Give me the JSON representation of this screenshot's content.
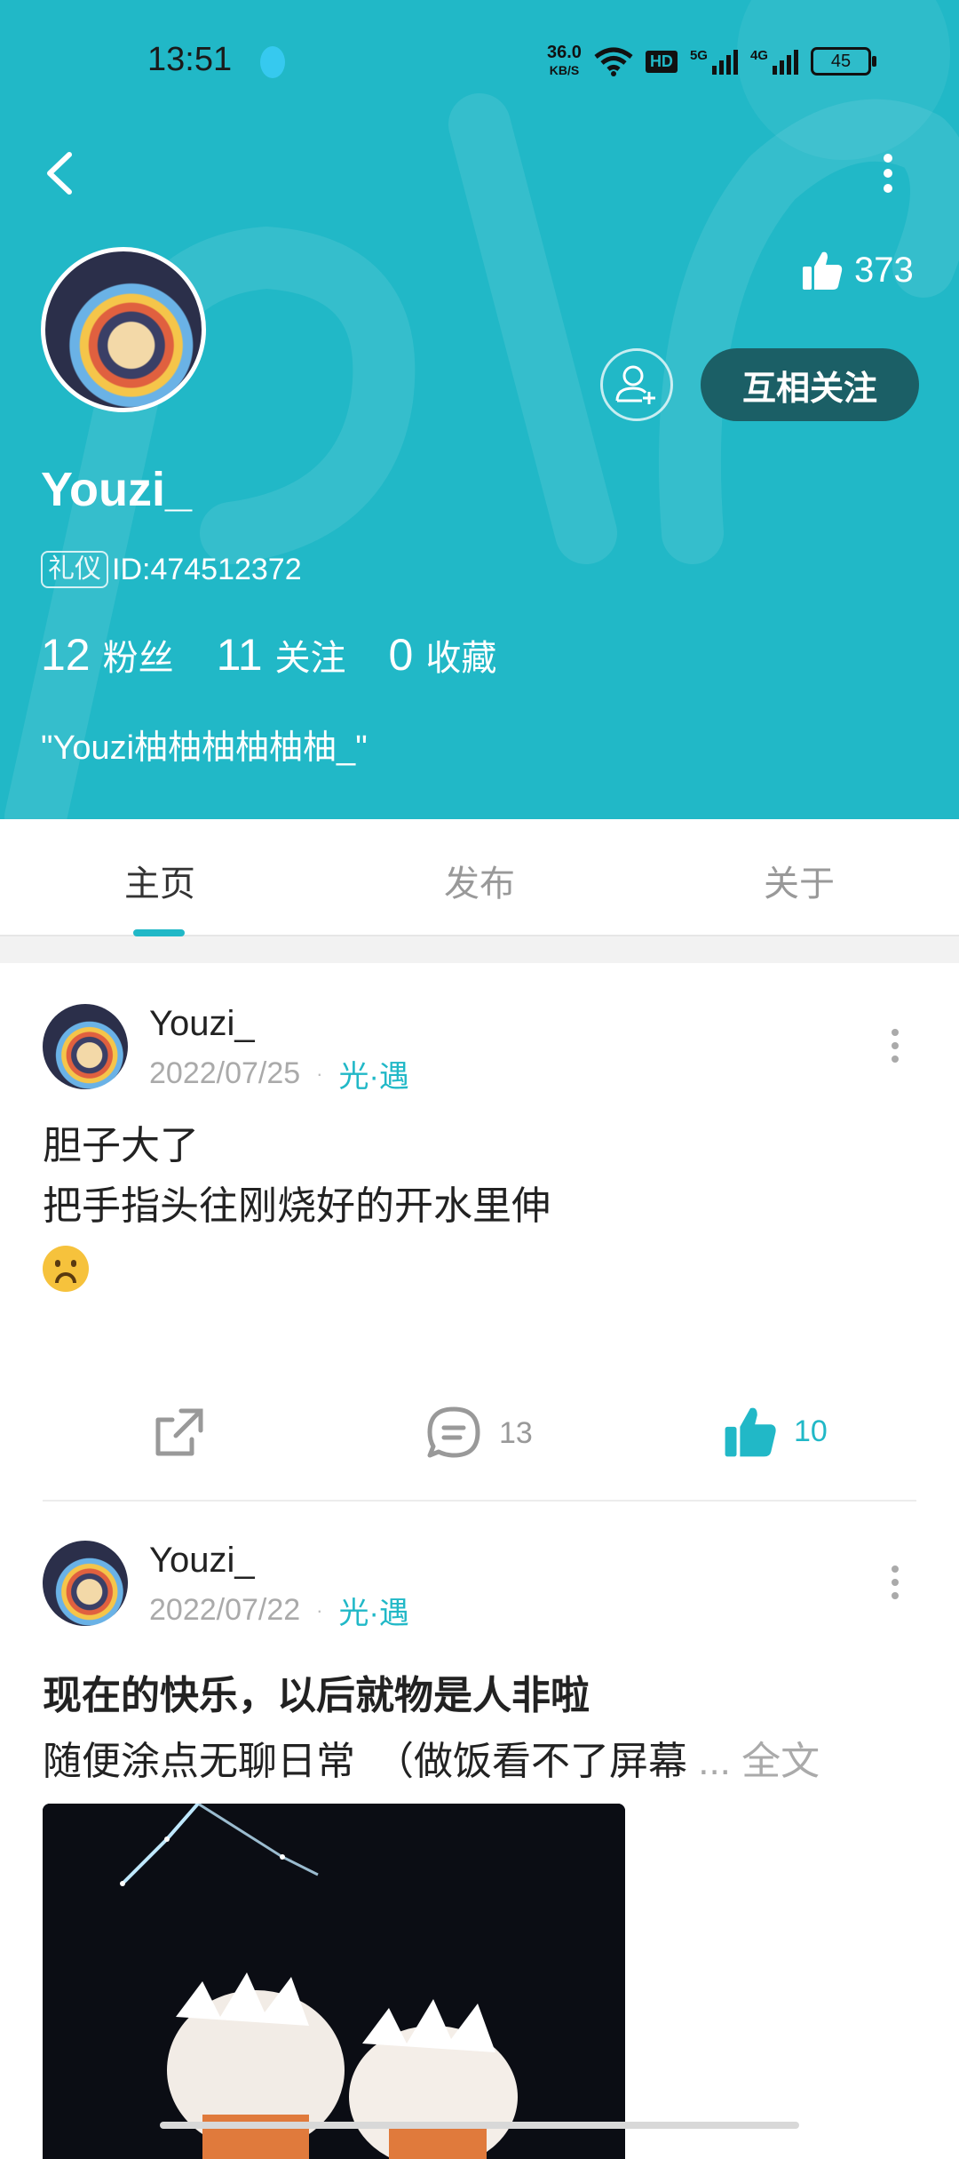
{
  "status_bar": {
    "time": "13:51",
    "net_speed_value": "36.0",
    "net_speed_unit": "KB/S",
    "hd": "HD",
    "sig1": "5G",
    "sig2": "4G",
    "battery": "45"
  },
  "profile": {
    "likes": "373",
    "mutual_follow_label": "互相关注",
    "username": "Youzi_",
    "tag": "礼仪",
    "id": "ID:474512372",
    "stats": [
      {
        "num": "12",
        "label": "粉丝"
      },
      {
        "num": "11",
        "label": "关注"
      },
      {
        "num": "0",
        "label": "收藏"
      }
    ],
    "signature": "\"Youzi柚柚柚柚柚柚_\""
  },
  "tabs": [
    {
      "label": "主页",
      "active": true
    },
    {
      "label": "发布",
      "active": false
    },
    {
      "label": "关于",
      "active": false
    }
  ],
  "posts": [
    {
      "author": "Youzi_",
      "date": "2022/07/25",
      "dot": "·",
      "circle": "光·遇",
      "lines": [
        "胆子大了",
        "把手指头往刚烧好的开水里伸"
      ],
      "comments": "13",
      "likes": "10"
    },
    {
      "author": "Youzi_",
      "date": "2022/07/22",
      "dot": "·",
      "circle": "光·遇",
      "title": "现在的快乐，以后就物是人非啦",
      "body": "随便涂点无聊日常　（做饭看不了屏幕",
      "more": "... 全文"
    }
  ],
  "colors": {
    "accent": "#21b8c7",
    "button_dark": "#1b5f66"
  },
  "icons": {
    "back": "chevron-left-icon",
    "more": "more-vertical-icon",
    "like": "thumbs-up-icon",
    "add_friend": "add-user-icon",
    "share": "share-icon",
    "comment": "comment-icon"
  }
}
